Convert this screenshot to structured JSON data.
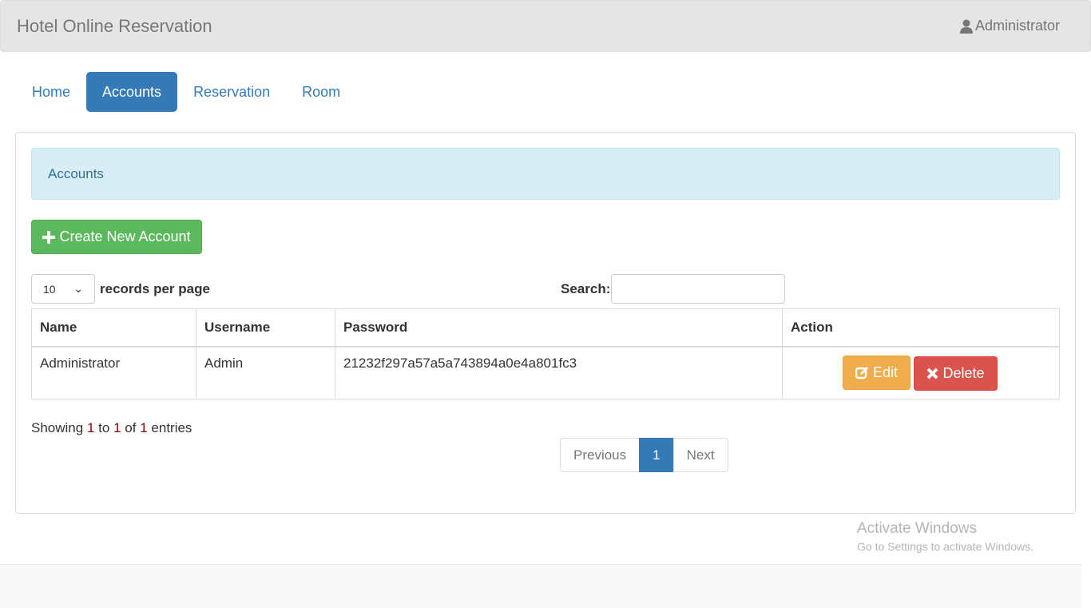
{
  "navbar": {
    "brand": "Hotel Online Reservation",
    "user": "Administrator",
    "user_icon": "user-icon"
  },
  "tabs": [
    {
      "label": "Home"
    },
    {
      "label": "Accounts",
      "active": true
    },
    {
      "label": "Reservation"
    },
    {
      "label": "Room"
    }
  ],
  "panel": {
    "heading": "Accounts",
    "create_button": "Create New Account"
  },
  "table_controls": {
    "page_size": "10",
    "records_label": "records per page",
    "search_label": "Search:",
    "search_value": ""
  },
  "table": {
    "columns": [
      "Name",
      "Username",
      "Password",
      "Action"
    ],
    "rows": [
      {
        "name": "Administrator",
        "username": "Admin",
        "password": "21232f297a57a5a743894a0e4a801fc3",
        "edit": "Edit",
        "delete": "Delete"
      }
    ]
  },
  "info": {
    "prefix": "Showing",
    "from": "1",
    "to_word": "to",
    "to": "1",
    "of_word": "of",
    "total": "1",
    "suffix": "entries"
  },
  "pagination": {
    "previous": "Previous",
    "current": "1",
    "next": "Next"
  },
  "watermark": {
    "title": "Activate Windows",
    "subtitle": "Go to Settings to activate Windows."
  },
  "colors": {
    "primary": "#337ab7",
    "success": "#5cb85c",
    "warning": "#f0ad4e",
    "danger": "#d9534f",
    "info_bg": "#d9edf7"
  }
}
